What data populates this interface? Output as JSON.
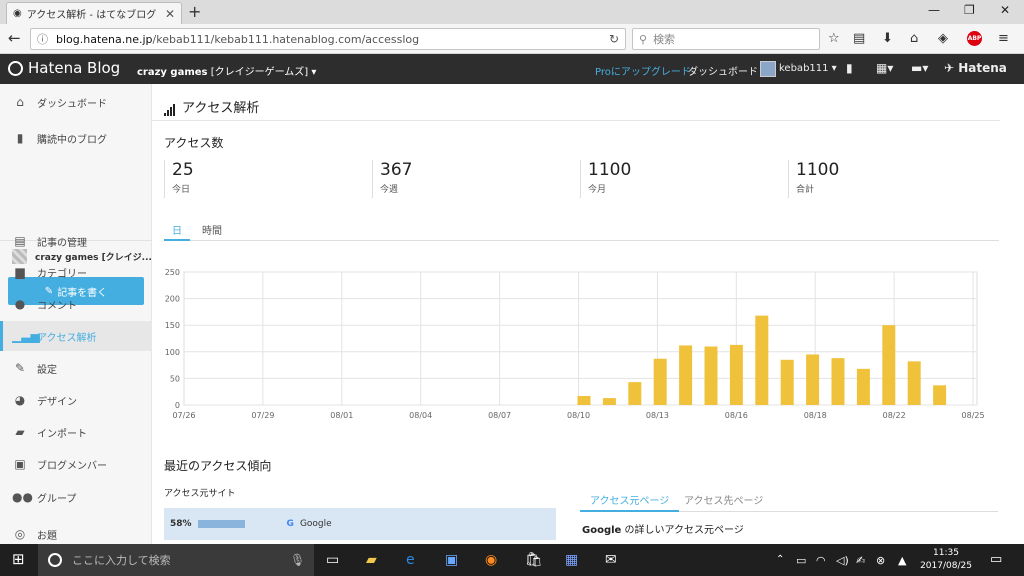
{
  "browser": {
    "tab_title": "アクセス解析 - はてなブログ",
    "url_domain": "blog.hatena.ne.jp",
    "url_path": "/kebab111/kebab111.hatenablog.com/accesslog",
    "search_placeholder": "検索",
    "abp_label": "ABP"
  },
  "hatena_bar": {
    "logo": "Hatena Blog",
    "blog_name": "crazy games",
    "blog_name_sub": "[クレイジーゲームズ]",
    "pro_label": "Pro",
    "upgrade_label": "にアップグレード",
    "dashboard_label": "ダッシュボード",
    "username": "kebab111",
    "hatena_label": "Hatena"
  },
  "sidebar": {
    "items": [
      {
        "label": "ダッシュボード",
        "icon": "home-icon"
      },
      {
        "label": "購読中のブログ",
        "icon": "bookmark-icon"
      },
      {
        "label": "記事の管理",
        "icon": "document-icon"
      },
      {
        "label": "カテゴリー",
        "icon": "folder-icon"
      },
      {
        "label": "コメント",
        "icon": "comment-icon"
      },
      {
        "label": "アクセス解析",
        "icon": "bars-icon"
      },
      {
        "label": "設定",
        "icon": "wrench-icon"
      },
      {
        "label": "デザイン",
        "icon": "palette-icon"
      },
      {
        "label": "インポート",
        "icon": "truck-icon"
      },
      {
        "label": "ブログメンバー",
        "icon": "member-icon"
      },
      {
        "label": "グループ",
        "icon": "group-icon"
      },
      {
        "label": "お題",
        "icon": "topic-icon"
      }
    ],
    "blog_entry": "crazy games [クレイジ...",
    "write_button": "記事を書く"
  },
  "main": {
    "page_title": "アクセス解析",
    "access_section": "アクセス数",
    "stats": [
      {
        "value": "25",
        "label": "今日"
      },
      {
        "value": "367",
        "label": "今週"
      },
      {
        "value": "1100",
        "label": "今月"
      },
      {
        "value": "1100",
        "label": "合計"
      }
    ],
    "tabs": [
      "日",
      "時間"
    ],
    "trend_section": "最近のアクセス傾向",
    "referrer_title": "アクセス元サイト",
    "referrer_percent": "58%",
    "referrer_name": "Google",
    "page_tabs": [
      "アクセス元ページ",
      "アクセス先ページ"
    ],
    "detail_title_bold": "Google",
    "detail_title_rest": " の詳しいアクセス元ページ"
  },
  "chart_data": {
    "type": "bar",
    "color": "#f0c23b",
    "y_ticks": [
      0,
      50,
      100,
      150,
      200,
      250
    ],
    "ylim": [
      0,
      250
    ],
    "x_tick_labels": [
      "07/26",
      "07/29",
      "08/01",
      "08/04",
      "08/07",
      "08/10",
      "08/13",
      "08/16",
      "08/18",
      "08/22",
      "08/25"
    ],
    "categories": [
      "08/11",
      "08/12",
      "08/13",
      "08/14",
      "08/15",
      "08/16",
      "08/17",
      "08/18",
      "08/19",
      "08/20",
      "08/21",
      "08/22",
      "08/23",
      "08/24",
      "08/25"
    ],
    "values": [
      17,
      13,
      43,
      87,
      112,
      110,
      113,
      168,
      85,
      95,
      88,
      68,
      150,
      82,
      37
    ]
  },
  "taskbar": {
    "search_placeholder": "ここに入力して検索",
    "time": "11:35",
    "date": "2017/08/25"
  }
}
